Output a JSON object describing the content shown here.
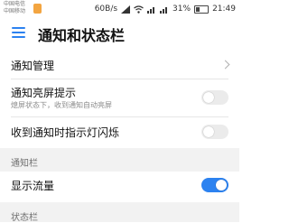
{
  "statusbar": {
    "carrier_1": "中国电信",
    "carrier_2": "中国移动",
    "speed": "60B/s",
    "battery": "31%",
    "time": "21:49"
  },
  "appbar": {
    "title": "通知和状态栏"
  },
  "settings": {
    "notification_manage": "通知管理",
    "screen_on_tip": "通知亮屏提示",
    "screen_on_tip_sub": "熄屏状态下，收到通知自动亮屏",
    "indicator_led": "收到通知时指示灯闪烁",
    "section_notification_bar": "通知栏",
    "show_traffic": "显示流量",
    "section_status_bar": "状态栏"
  },
  "toggles": {
    "screen_on_tip": false,
    "indicator_led": false,
    "show_traffic": true
  },
  "colors": {
    "accent": "#2c82f0",
    "section_bg": "#f2f2f2"
  }
}
